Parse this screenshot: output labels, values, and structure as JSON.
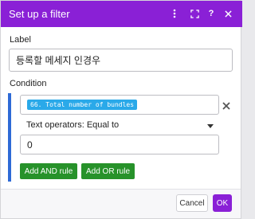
{
  "dialog": {
    "title": "Set up a filter"
  },
  "label_field": {
    "label": "Label",
    "value": "등록할 메세지 인경우"
  },
  "condition": {
    "label": "Condition",
    "operand_pill": "66. Total number of bundles",
    "operator_value": "Text operators: Equal to",
    "second_value": "0",
    "add_and_label": "Add AND rule",
    "add_or_label": "Add OR rule"
  },
  "footer": {
    "cancel_label": "Cancel",
    "ok_label": "OK"
  },
  "icons": {
    "menu": "vertical-ellipsis-icon",
    "expand": "expand-arrows-icon",
    "help": "question-icon",
    "close": "close-icon",
    "remove_condition": "remove-icon",
    "dropdown": "caret-down-icon"
  },
  "colors": {
    "accent": "#8a20d6",
    "condition_bar": "#2e6ad6",
    "pill": "#2aa9e9",
    "add_button": "#27922a"
  }
}
